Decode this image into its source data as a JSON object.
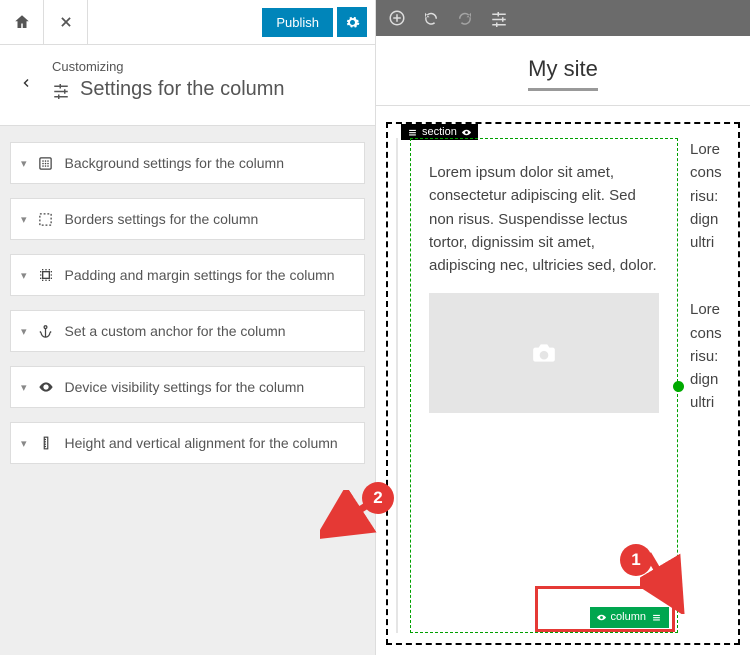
{
  "topbar": {
    "publish_label": "Publish"
  },
  "header": {
    "crumb": "Customizing",
    "title": "Settings for the column"
  },
  "sections": [
    {
      "key": "bg",
      "label": "Background settings for the column"
    },
    {
      "key": "borders",
      "label": "Borders settings for the column"
    },
    {
      "key": "padding",
      "label": "Padding and margin settings for the column"
    },
    {
      "key": "anchor",
      "label": "Set a custom anchor for the column"
    },
    {
      "key": "visibility",
      "label": "Device visibility settings for the column"
    },
    {
      "key": "height",
      "label": "Height and vertical alignment for the column"
    }
  ],
  "canvas": {
    "site_title": "My site",
    "section_tag": "section",
    "column_tag": "column",
    "lorem": "Lorem ipsum dolor sit amet, consectetur adipiscing elit. Sed non risus. Suspendisse lectus tortor, dignissim sit amet, adipiscing nec, ultricies sed, dolor.",
    "lorem2a": "Lore\ncons\nrisu:\ndign\nultri",
    "lorem2b": "Lore\ncons\nrisu:\ndign\nultri"
  },
  "callouts": {
    "one": "1",
    "two": "2"
  }
}
